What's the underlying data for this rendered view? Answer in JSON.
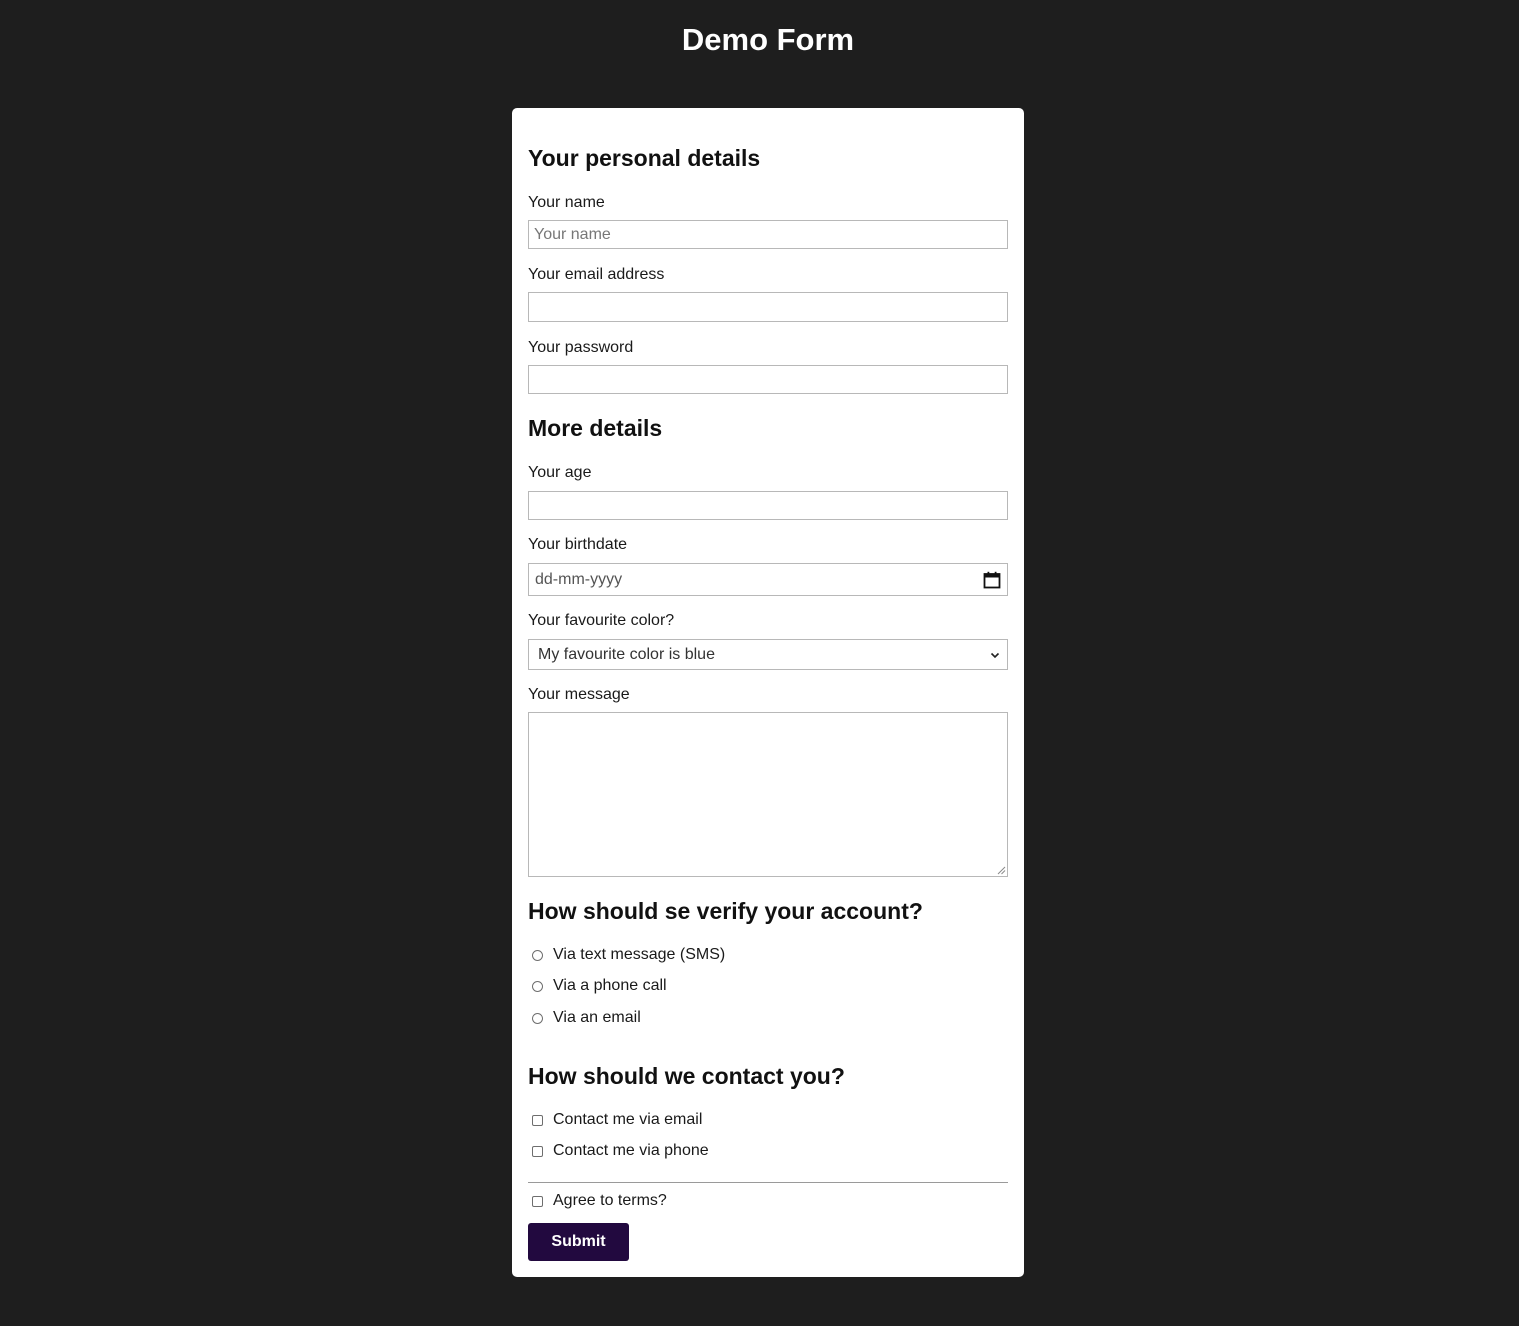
{
  "page": {
    "title": "Demo Form"
  },
  "colors": {
    "page_background": "#1e1e1e",
    "card_background": "#ffffff",
    "submit_background": "#22093f"
  },
  "personal": {
    "heading": "Your personal details",
    "name_label": "Your name",
    "name_placeholder": "Your name",
    "name_value": "",
    "email_label": "Your email address",
    "email_value": "",
    "password_label": "Your password",
    "password_value": ""
  },
  "more": {
    "heading": "More details",
    "age_label": "Your age",
    "age_value": "",
    "birthdate_label": "Your birthdate",
    "birthdate_placeholder": "dd-mm-yyyy",
    "birthdate_icon": "calendar-icon",
    "color_label": "Your favourite color?",
    "color_selected": "My favourite color is blue",
    "color_icon": "chevron-down-icon",
    "message_label": "Your message",
    "message_value": ""
  },
  "verify": {
    "heading": "How should se verify your account?",
    "options": [
      {
        "label": "Via text message (SMS)",
        "selected": false
      },
      {
        "label": "Via a phone call",
        "selected": false
      },
      {
        "label": "Via an email",
        "selected": false
      }
    ]
  },
  "contact": {
    "heading": "How should we contact you?",
    "options": [
      {
        "label": "Contact me via email",
        "checked": false
      },
      {
        "label": "Contact me via phone",
        "checked": false
      }
    ]
  },
  "terms": {
    "label": "Agree to terms?",
    "checked": false
  },
  "submit": {
    "label": "Submit"
  }
}
